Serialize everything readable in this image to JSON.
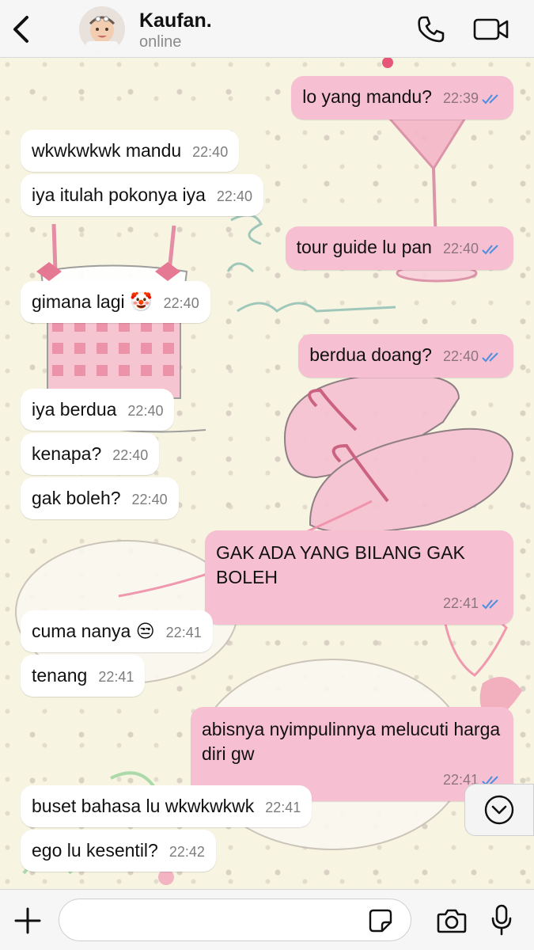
{
  "header": {
    "contact_name": "Kaufan.",
    "status": "online"
  },
  "messages": [
    {
      "dir": "out",
      "text": "lo yang mandu?",
      "time": "22:39",
      "read": true
    },
    {
      "dir": "in",
      "text": "wkwkwkwk mandu",
      "time": "22:40"
    },
    {
      "dir": "in",
      "text": "iya itulah pokonya iya",
      "time": "22:40"
    },
    {
      "dir": "out",
      "text": "tour guide lu pan",
      "time": "22:40",
      "read": true
    },
    {
      "dir": "in",
      "text": "gimana lagi 🤡",
      "time": "22:40"
    },
    {
      "dir": "out",
      "text": "berdua doang?",
      "time": "22:40",
      "read": true
    },
    {
      "dir": "in",
      "text": "iya berdua",
      "time": "22:40"
    },
    {
      "dir": "in",
      "text": "kenapa?",
      "time": "22:40"
    },
    {
      "dir": "in",
      "text": "gak boleh?",
      "time": "22:40"
    },
    {
      "dir": "out",
      "text": "GAK ADA YANG BILANG GAK BOLEH",
      "time": "22:41",
      "read": true
    },
    {
      "dir": "in",
      "text": "cuma nanya 😒",
      "time": "22:41"
    },
    {
      "dir": "in",
      "text": "tenang",
      "time": "22:41"
    },
    {
      "dir": "out",
      "text": "abisnya nyimpulinnya melucuti harga diri gw",
      "time": "22:41",
      "read": true
    },
    {
      "dir": "in",
      "text": "buset bahasa lu wkwkwkwk",
      "time": "22:41"
    },
    {
      "dir": "in",
      "text": "ego lu kesentil?",
      "time": "22:42"
    }
  ],
  "composer": {
    "placeholder": ""
  },
  "icons": {
    "back": "chevron-left-icon",
    "call": "phone-icon",
    "video": "video-camera-icon",
    "scroll_down": "chevron-down-circle-icon",
    "add": "plus-icon",
    "sticker": "sticker-icon",
    "camera": "camera-icon",
    "mic": "microphone-icon"
  },
  "colors": {
    "outgoing_bubble": "#f7bfd2",
    "incoming_bubble": "#ffffff",
    "read_ticks": "#4a8fe0",
    "chat_background": "#f8f4e2"
  }
}
